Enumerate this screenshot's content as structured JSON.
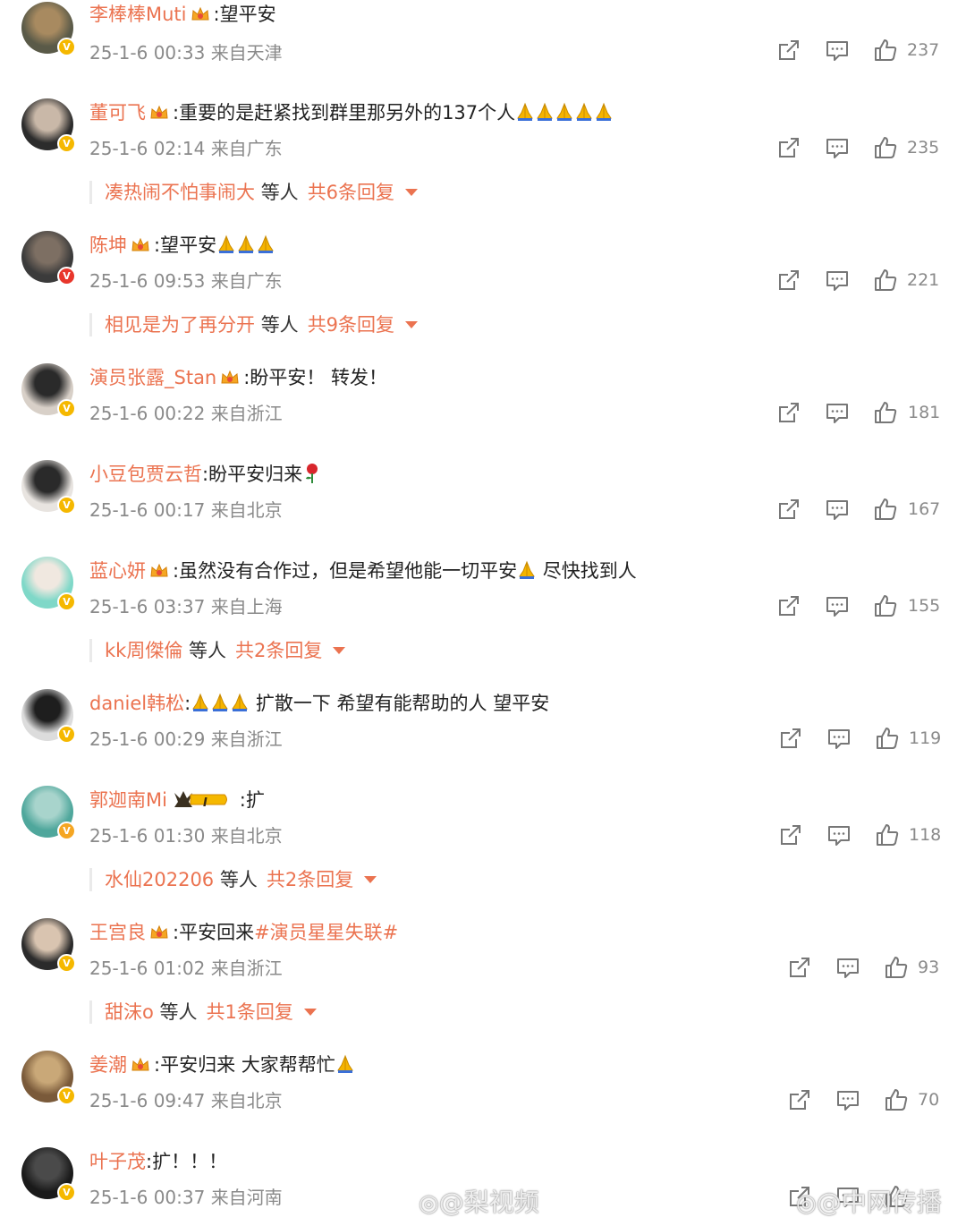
{
  "comments": [
    {
      "username": "李棒棒Muti",
      "text": ":望平安",
      "time": "25-1-6 00:33",
      "location": "来自天津",
      "likes": "237",
      "badge_color": "#f5b800",
      "avatar_colors": [
        "#5a5a48",
        "#a88a60"
      ]
    },
    {
      "username": "董可飞",
      "text": ":重要的是赶紧找到群里那另外的137个人",
      "time": "25-1-6 02:14",
      "location": "来自广东",
      "likes": "235",
      "badge_color": "#f5b800",
      "avatar_colors": [
        "#2c2c2c",
        "#c9b8a8"
      ],
      "replies": {
        "name": "凑热闹不怕事闹大",
        "suffix": "等人",
        "count": "共6条回复"
      }
    },
    {
      "username": "陈坤",
      "text": ":望平安",
      "time": "25-1-6 09:53",
      "location": "来自广东",
      "likes": "221",
      "badge_color": "#e8362b",
      "avatar_colors": [
        "#3b3b3b",
        "#7d6f63"
      ],
      "replies": {
        "name": "相见是为了再分开",
        "suffix": "等人",
        "count": "共9条回复"
      }
    },
    {
      "username": "演员张露_Stan",
      "text": ":盼平安！ 转发！",
      "time": "25-1-6 00:22",
      "location": "来自浙江",
      "likes": "181",
      "badge_color": "#f5b800",
      "avatar_colors": [
        "#d8d0c8",
        "#2a2a2a"
      ]
    },
    {
      "username": "小豆包贾云哲",
      "text": ":盼平安归来",
      "time": "25-1-6 00:17",
      "location": "来自北京",
      "likes": "167",
      "badge_color": "#f5b800",
      "avatar_colors": [
        "#e8e4e0",
        "#2a2a2a"
      ]
    },
    {
      "username": "蓝心妍",
      "text": ":虽然没有合作过，但是希望他能一切平安",
      "text2": "尽快找到人",
      "time": "25-1-6 03:37",
      "location": "来自上海",
      "likes": "155",
      "badge_color": "#f5b800",
      "avatar_colors": [
        "#7fd8c8",
        "#f0e8e0"
      ],
      "replies": {
        "name": "kk周傑倫",
        "suffix": "等人",
        "count": "共2条回复"
      }
    },
    {
      "username": "daniel韩松",
      "text": ":",
      "text2": "扩散一下 希望有能帮助的人 望平安",
      "time": "25-1-6 00:29",
      "location": "来自浙江",
      "likes": "119",
      "badge_color": "#f5b800",
      "avatar_colors": [
        "#dcdcdc",
        "#1e1e1e"
      ]
    },
    {
      "username": "郭迦南Mi",
      "text": ":扩",
      "level": "I",
      "time": "25-1-6 01:30",
      "location": "来自北京",
      "likes": "118",
      "badge_color": "#f5a623",
      "avatar_colors": [
        "#4fa79c",
        "#a8d4cc"
      ],
      "replies": {
        "name": "水仙202206",
        "suffix": "等人",
        "count": "共2条回复"
      }
    },
    {
      "username": "王宫良",
      "text": ":平安回来",
      "topic": "#演员星星失联#",
      "time": "25-1-6 01:02",
      "location": "来自浙江",
      "likes": "93",
      "badge_color": "#f5b800",
      "avatar_colors": [
        "#2b2b2b",
        "#d9c4b0"
      ],
      "replies": {
        "name": "甜沫o",
        "suffix": "等人",
        "count": "共1条回复"
      }
    },
    {
      "username": "姜潮",
      "text": ":平安归来 大家帮帮忙",
      "time": "25-1-6 09:47",
      "location": "来自北京",
      "likes": "70",
      "badge_color": "#f5b800",
      "avatar_colors": [
        "#7a5a3a",
        "#c9a878"
      ]
    },
    {
      "username": "叶子茂",
      "text": ":扩！！！",
      "time": "25-1-6 00:37",
      "location": "来自河南",
      "likes": "",
      "badge_color": "#f5b800",
      "avatar_colors": [
        "#1a1a1a",
        "#4a4a4a"
      ]
    }
  ],
  "watermarks": {
    "left": "@梨视频",
    "right": "@中网传播"
  },
  "colors": {
    "accent": "#eb7350",
    "meta": "#8a8a8a"
  }
}
